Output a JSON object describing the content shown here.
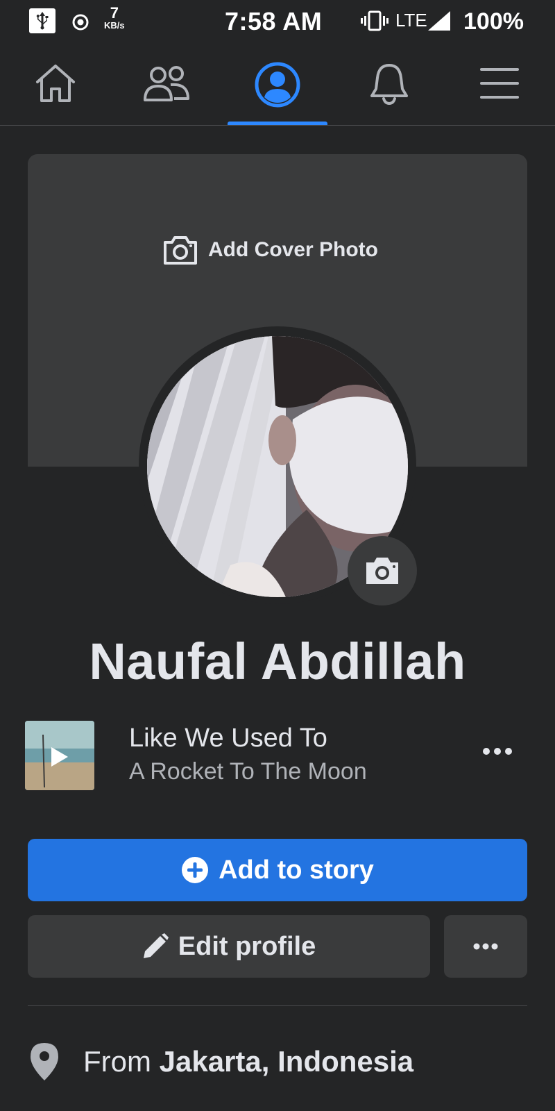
{
  "status_bar": {
    "net_speed_value": "7",
    "net_speed_unit": "KB/s",
    "time": "7:58 AM",
    "network": "LTE",
    "battery": "100%",
    "icons": [
      "usb-icon",
      "target-icon",
      "vibrate-icon",
      "signal-icon"
    ]
  },
  "nav": {
    "tabs": [
      {
        "name": "home",
        "icon": "home-icon"
      },
      {
        "name": "friends",
        "icon": "friends-icon"
      },
      {
        "name": "profile",
        "icon": "profile-icon",
        "active": true
      },
      {
        "name": "notifications",
        "icon": "bell-icon"
      },
      {
        "name": "menu",
        "icon": "hamburger-menu-icon"
      }
    ],
    "active_color": "#2d88ff"
  },
  "cover": {
    "add_label": "Add Cover Photo"
  },
  "profile": {
    "name": "Naufal Abdillah"
  },
  "music": {
    "title": "Like We Used To",
    "artist": "A Rocket To The Moon"
  },
  "actions": {
    "add_story": "Add to story",
    "edit_profile": "Edit profile"
  },
  "details": {
    "from_prefix": "From ",
    "from_place": "Jakarta, Indonesia"
  },
  "colors": {
    "background": "#242526",
    "surface": "#3a3b3c",
    "primary": "#2374e1",
    "text": "#e4e6eb",
    "secondary_text": "#b0b3b8"
  }
}
